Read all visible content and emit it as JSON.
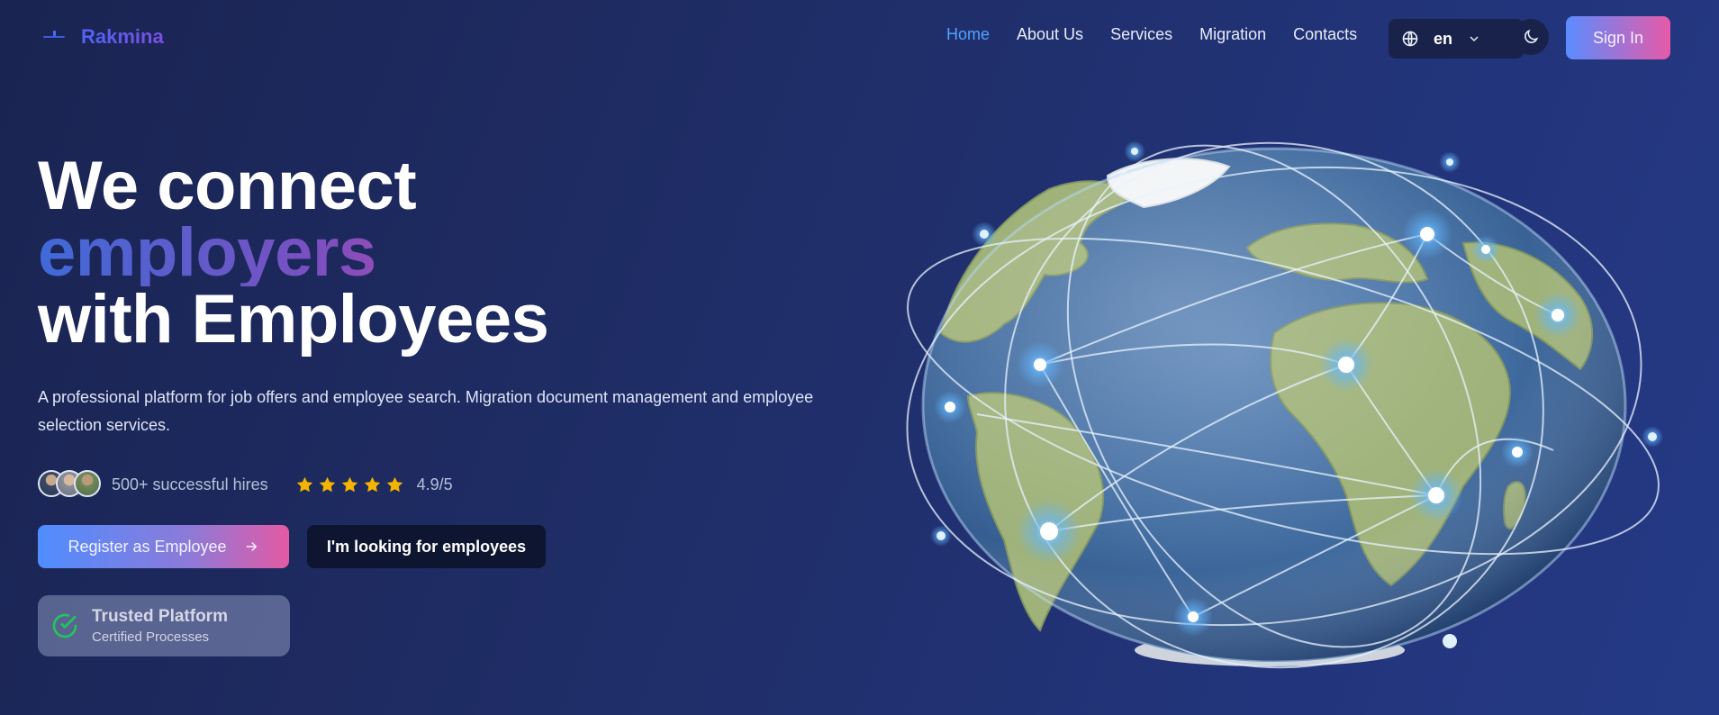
{
  "brand": {
    "name": "Rakmina"
  },
  "nav": {
    "items": [
      {
        "label": "Home",
        "active": true
      },
      {
        "label": "About Us",
        "active": false
      },
      {
        "label": "Services",
        "active": false
      },
      {
        "label": "Migration",
        "active": false
      },
      {
        "label": "Contacts",
        "active": false
      }
    ]
  },
  "language": {
    "current": "en"
  },
  "header": {
    "signin_label": "Sign In"
  },
  "hero": {
    "title_line1": "We connect",
    "title_line2": "employers",
    "title_line3": "with Employees",
    "description": "A professional platform for job offers and employee search. Migration document management and employee selection services.",
    "hires_text": "500+ successful hires",
    "rating_text": "4.9/5",
    "stars": 5,
    "primary_button": "Register as Employee",
    "secondary_button": "I'm looking for employees",
    "trust_title": "Trusted Platform",
    "trust_subtitle": "Certified Processes"
  },
  "colors": {
    "accent_blue": "#4fa3ff",
    "gradient_start": "#4f8dff",
    "gradient_end": "#e45aa5",
    "star": "#f5b400",
    "check": "#22c55e"
  },
  "icons": {
    "language": "globe-icon",
    "dropdown": "chevron-down-icon",
    "theme": "moon-icon",
    "arrow": "arrow-right-icon",
    "trust": "check-circle-icon"
  }
}
